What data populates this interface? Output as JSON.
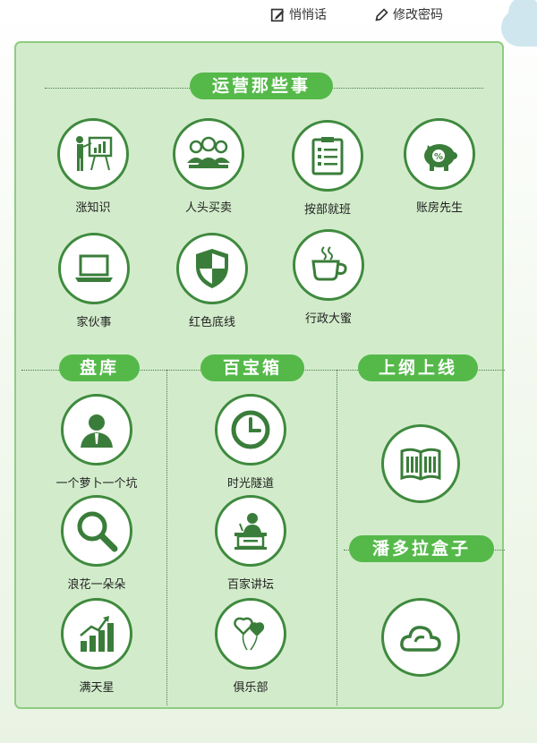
{
  "header": {
    "messages_label": "悄悄话",
    "password_label": "修改密码"
  },
  "colors": {
    "accent": "#55b94a",
    "icon": "#3a7d3a",
    "panel_bg": "#d2eccb",
    "border": "#8fcc82"
  },
  "sections": {
    "operations": {
      "title": "运营那些事",
      "items": [
        {
          "label": "涨知识",
          "icon": "presentation-icon"
        },
        {
          "label": "人头买卖",
          "icon": "people-icon"
        },
        {
          "label": "按部就班",
          "icon": "clipboard-icon"
        },
        {
          "label": "账房先生",
          "icon": "piggy-bank-icon"
        },
        {
          "label": "家伙事",
          "icon": "laptop-icon"
        },
        {
          "label": "红色底线",
          "icon": "shield-icon"
        },
        {
          "label": "行政大蜜",
          "icon": "coffee-cup-icon"
        }
      ]
    },
    "inventory": {
      "title": "盘库",
      "items": [
        {
          "label": "一个萝卜一个坑",
          "icon": "person-icon"
        },
        {
          "label": "浪花一朵朵",
          "icon": "magnifier-icon"
        },
        {
          "label": "满天星",
          "icon": "growth-chart-icon"
        }
      ]
    },
    "treasure": {
      "title": "百宝箱",
      "items": [
        {
          "label": "时光隧道",
          "icon": "clock-icon"
        },
        {
          "label": "百家讲坛",
          "icon": "lectern-icon"
        },
        {
          "label": "俱乐部",
          "icon": "balloons-icon"
        }
      ]
    },
    "online": {
      "title": "上纲上线",
      "items": [
        {
          "icon": "book-icon"
        }
      ]
    },
    "pandora": {
      "title": "潘多拉盒子",
      "items": [
        {
          "icon": "cloud-icon"
        }
      ]
    }
  }
}
